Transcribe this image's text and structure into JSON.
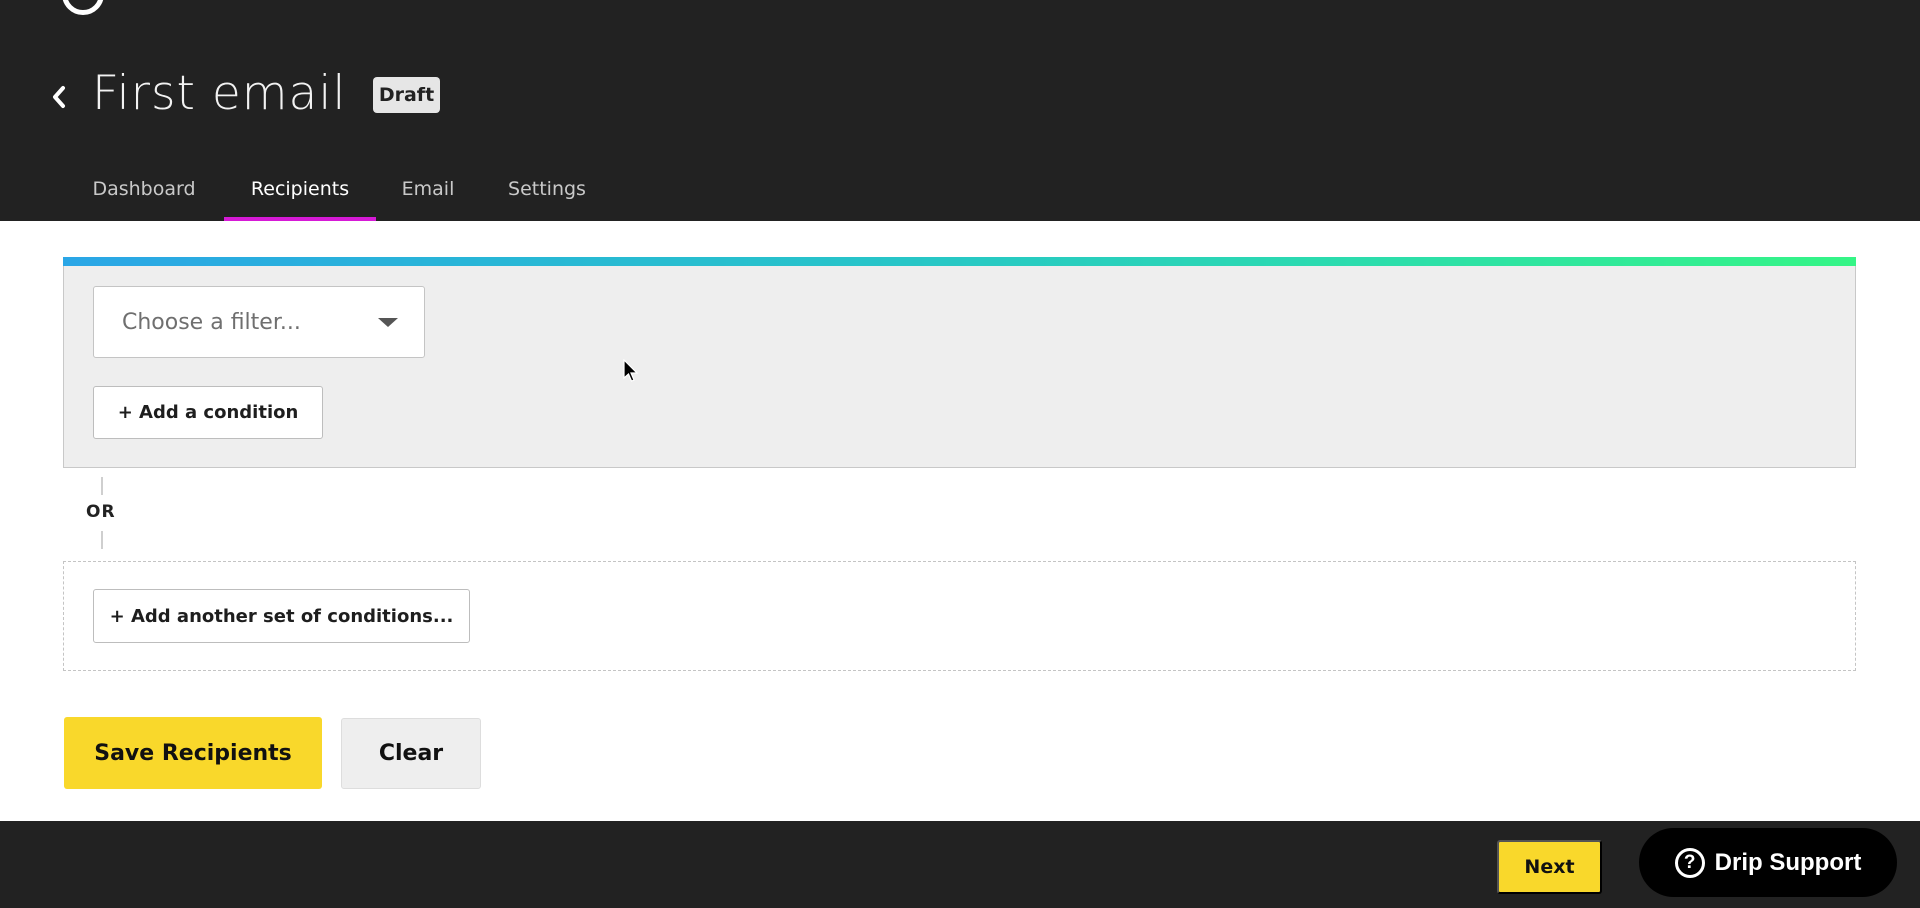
{
  "header": {
    "logo_icon": "drip-ring-logo",
    "back_icon": "chevron-left-icon",
    "title": "First email",
    "status_badge": "Draft",
    "tabs": [
      {
        "label": "Dashboard",
        "active": false
      },
      {
        "label": "Recipients",
        "active": true
      },
      {
        "label": "Email",
        "active": false
      },
      {
        "label": "Settings",
        "active": false
      }
    ],
    "active_tab_color": "#d61ad6"
  },
  "filters": {
    "group": {
      "filter_select": {
        "placeholder": "Choose a filter...",
        "value": "",
        "icon": "caret-down-icon"
      },
      "add_condition_label": "+ Add a condition"
    },
    "connector_label": "OR",
    "add_set_label": "+ Add another set of conditions..."
  },
  "actions": {
    "save_label": "Save Recipients",
    "clear_label": "Clear"
  },
  "footer": {
    "next_label": "Next",
    "support_icon": "question-circle-icon",
    "support_icon_glyph": "?",
    "support_label": "Drip Support"
  },
  "colors": {
    "primary_yellow": "#f9d82b",
    "header_bg": "#222222",
    "accent_gradient_start": "#2aa6e6",
    "accent_gradient_end": "#35f586"
  }
}
